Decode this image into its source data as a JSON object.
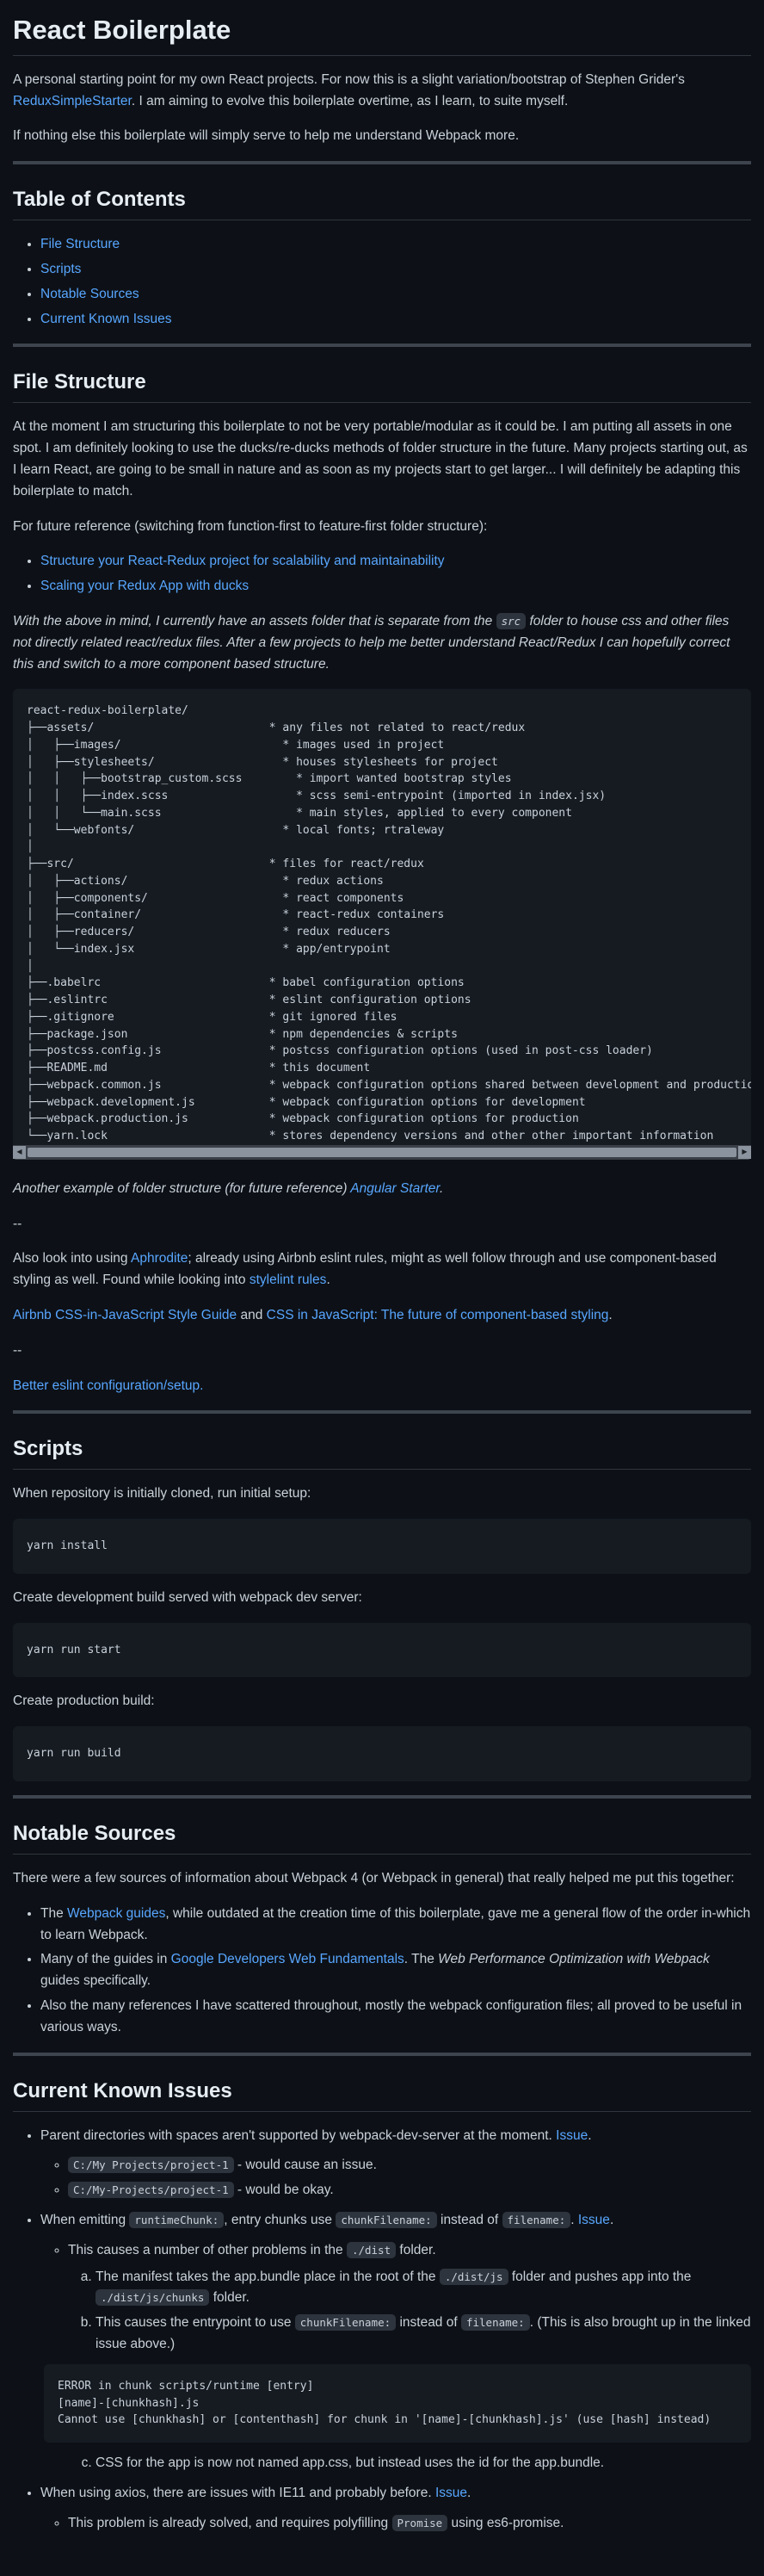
{
  "title": "React Boilerplate",
  "intro": {
    "p1_a": "A personal starting point for my own React projects. For now this is a slight variation/bootstrap of Stephen Grider's ",
    "p1_link": "ReduxSimpleStarter",
    "p1_b": ". I am aiming to evolve this boilerplate overtime, as I learn, to suite myself.",
    "p2": "If nothing else this boilerplate will simply serve to help me understand Webpack more."
  },
  "toc": {
    "heading": "Table of Contents",
    "items": [
      "File Structure",
      "Scripts",
      "Notable Sources",
      "Current Known Issues"
    ]
  },
  "file_structure": {
    "heading": "File Structure",
    "p1": "At the moment I am structuring this boilerplate to not be very portable/modular as it could be. I am putting all assets in one spot. I am definitely looking to use the ducks/re-ducks methods of folder structure in the future. Many projects starting out, as I learn React, are going to be small in nature and as soon as my projects start to get larger... I will definitely be adapting this boilerplate to match.",
    "p2": "For future reference (switching from function-first to feature-first folder structure):",
    "links": [
      "Structure your React-Redux project for scalability and maintainability",
      "Scaling your Redux App with ducks"
    ],
    "note_a": "With the above in mind, I currently have an assets folder that is separate from the ",
    "note_code": "src",
    "note_b": " folder to house css and other files not directly related react/redux files. After a few projects to help me better understand React/Redux I can hopefully correct this and switch to a more component based structure.",
    "tree": "react-redux-boilerplate/\n├──assets/                          * any files not related to react/redux\n│   ├──images/                        * images used in project\n│   ├──stylesheets/                   * houses stylesheets for project\n│   │   ├──bootstrap_custom.scss        * import wanted bootstrap styles\n│   │   ├──index.scss                   * scss semi-entrypoint (imported in index.jsx)\n│   │   └──main.scss                    * main styles, applied to every component\n│   └──webfonts/                      * local fonts; rtraleway\n│\n├──src/                             * files for react/redux\n│   ├──actions/                       * redux actions\n│   ├──components/                    * react components\n│   ├──container/                     * react-redux containers\n│   ├──reducers/                      * redux reducers\n│   └──index.jsx                      * app/entrypoint\n│\n├──.babelrc                         * babel configuration options\n├──.eslintrc                        * eslint configuration options\n├──.gitignore                       * git ignored files\n├──package.json                     * npm dependencies & scripts\n├──postcss.config.js                * postcss configuration options (used in post-css loader)\n├──README.md                        * this document\n├──webpack.common.js                * webpack configuration options shared between development and production\n├──webpack.development.js           * webpack configuration options for development\n├──webpack.production.js            * webpack configuration options for production\n└──yarn.lock                        * stores dependency versions and other other important information",
    "another_a": "Another example of folder structure (for future reference) ",
    "another_link": "Angular Starter",
    "another_b": ".",
    "dash1": "--",
    "also_a": "Also look into using ",
    "also_link1": "Aphrodite",
    "also_b": "; already using Airbnb eslint rules, might as well follow through and use component-based styling as well. Found while looking into ",
    "also_link2": "stylelint rules",
    "also_c": ".",
    "airbnb_link": "Airbnb CSS-in-JavaScript Style Guide",
    "and": " and ",
    "css_link": "CSS in JavaScript: The future of component-based styling",
    "period": ".",
    "dash2": "--",
    "eslint_link": "Better eslint configuration/setup."
  },
  "scripts": {
    "heading": "Scripts",
    "p1": "When repository is initially cloned, run initial setup:",
    "c1": "yarn install",
    "p2": "Create development build served with webpack dev server:",
    "c2": "yarn run start",
    "p3": "Create production build:",
    "c3": "yarn run build"
  },
  "notable": {
    "heading": "Notable Sources",
    "p1": "There were a few sources of information about Webpack 4 (or Webpack in general) that really helped me put this together:",
    "i1_a": "The ",
    "i1_link": "Webpack guides",
    "i1_b": ", while outdated at the creation time of this boilerplate, gave me a general flow of the order in-which to learn Webpack.",
    "i2_a": "Many of the guides in ",
    "i2_link": "Google Developers Web Fundamentals",
    "i2_b": ". The ",
    "i2_em": "Web Performance Optimization with Webpack",
    "i2_c": " guides specifically.",
    "i3": "Also the many references I have scattered throughout, mostly the webpack configuration files; all proved to be useful in various ways."
  },
  "issues": {
    "heading": "Current Known Issues",
    "i1_text": "Parent directories with spaces aren't supported by webpack-dev-server at the moment. ",
    "i1_link": "Issue",
    "i1_end": ".",
    "i1_s1_code": "C:/My Projects/project-1",
    "i1_s1_text": " - would cause an issue.",
    "i1_s2_code": "C:/My-Projects/project-1",
    "i1_s2_text": " - would be okay.",
    "i2_a": "When emitting ",
    "i2_code1": "runtimeChunk:",
    "i2_b": ", entry chunks use ",
    "i2_code2": "chunkFilename:",
    "i2_c": " instead of ",
    "i2_code3": "filename:",
    "i2_d": ". ",
    "i2_link": "Issue",
    "i2_end": ".",
    "i2_s1_a": "This causes a number of other problems in the ",
    "i2_s1_code": "./dist",
    "i2_s1_b": " folder.",
    "a_text1": "The manifest takes the app.bundle place in the root of the ",
    "a_code1": "./dist/js",
    "a_text2": " folder and pushes app into the ",
    "a_code2": "./dist/js/chunks",
    "a_text3": " folder.",
    "b_text1": "This causes the entrypoint to use ",
    "b_code1": "chunkFilename:",
    "b_text2": " instead of ",
    "b_code2": "filename:",
    "b_text3": ". (This is also brought up in the linked issue above.)",
    "error_block": "ERROR in chunk scripts/runtime [entry]\n[name]-[chunkhash].js\nCannot use [chunkhash] or [contenthash] for chunk in '[name]-[chunkhash].js' (use [hash] instead)",
    "c_text": "CSS for the app is now not named app.css, but instead uses the id for the app.bundle.",
    "i3_text": "When using axios, there are issues with IE11 and probably before. ",
    "i3_link": "Issue",
    "i3_end": ".",
    "i3_s1_a": "This problem is already solved, and requires polyfilling ",
    "i3_s1_code": "Promise",
    "i3_s1_b": " using es6-promise."
  },
  "colors": {
    "background": "#0d1117",
    "text": "#c9d1d9",
    "link": "#58a6ff",
    "code_bg": "#161b22",
    "rule": "#3d444d"
  }
}
